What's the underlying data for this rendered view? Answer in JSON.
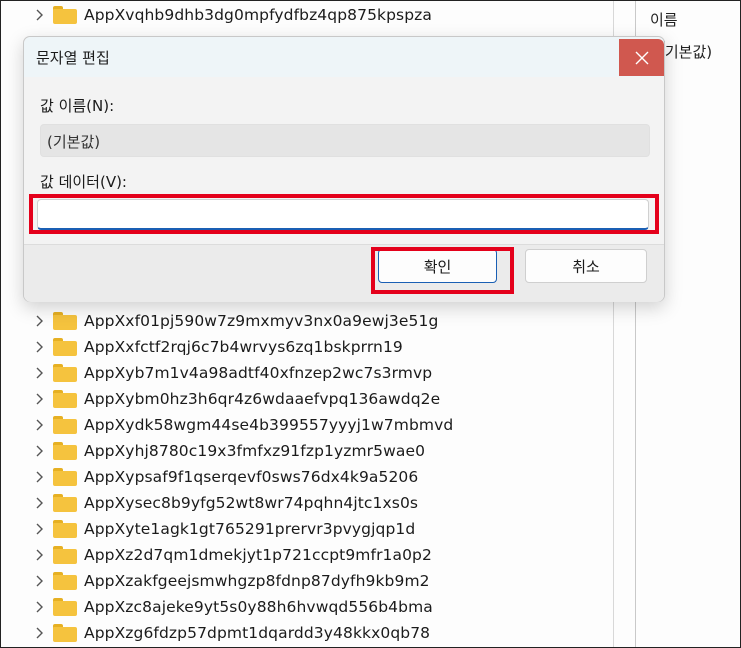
{
  "tree": {
    "top_items": [
      "AppXvqhb9dhb3dg0mpfydfbz4qp875kpspza"
    ],
    "items": [
      "AppXxf01pj590w7z9mxmyv3nx0a9ewj3e51g",
      "AppXxfctf2rqj6c7b4wrvys6zq1bskprrn19",
      "AppXyb7m1v4a98adtf40xfnzep2wc7s3rmvp",
      "AppXybm0hz3h6qr4z6wdaaefvpq136awdq2e",
      "AppXydk58wgm44se4b399557yyyj1w7mbmvd",
      "AppXyhj8780c19x3fmfxz91fzp1yzmr5wae0",
      "AppXypsaf9f1qserqevf0sws76dx4k9a5206",
      "AppXysec8b9yfg52wt8wr74pqhn4jtc1xs0s",
      "AppXyte1agk1gt765291prervr3pvygjqp1d",
      "AppXz2d7qm1dmekjyt1p721ccpt9mfr1a0p2",
      "AppXzakfgeejsmwhgzp8fdnp87dyfh9kb9m2",
      "AppXzc8ajeke9yt5s0y88h6hvwqd556b4bma",
      "AppXzg6fdzp57dpmt1dqardd3y48kkx0qb78"
    ]
  },
  "right_pane": {
    "column_header": "이름",
    "default_entry": "(기본값)"
  },
  "dialog": {
    "title": "문자열 편집",
    "value_name_label": "값 이름(N):",
    "value_name": "(기본값)",
    "value_data_label": "값 데이터(V):",
    "value_data": "",
    "ok_label": "확인",
    "cancel_label": "취소"
  },
  "colors": {
    "highlight": "#e4001b",
    "folder": "#f5c33e",
    "accent": "#1a5fb4",
    "close_button": "#d0584f"
  }
}
